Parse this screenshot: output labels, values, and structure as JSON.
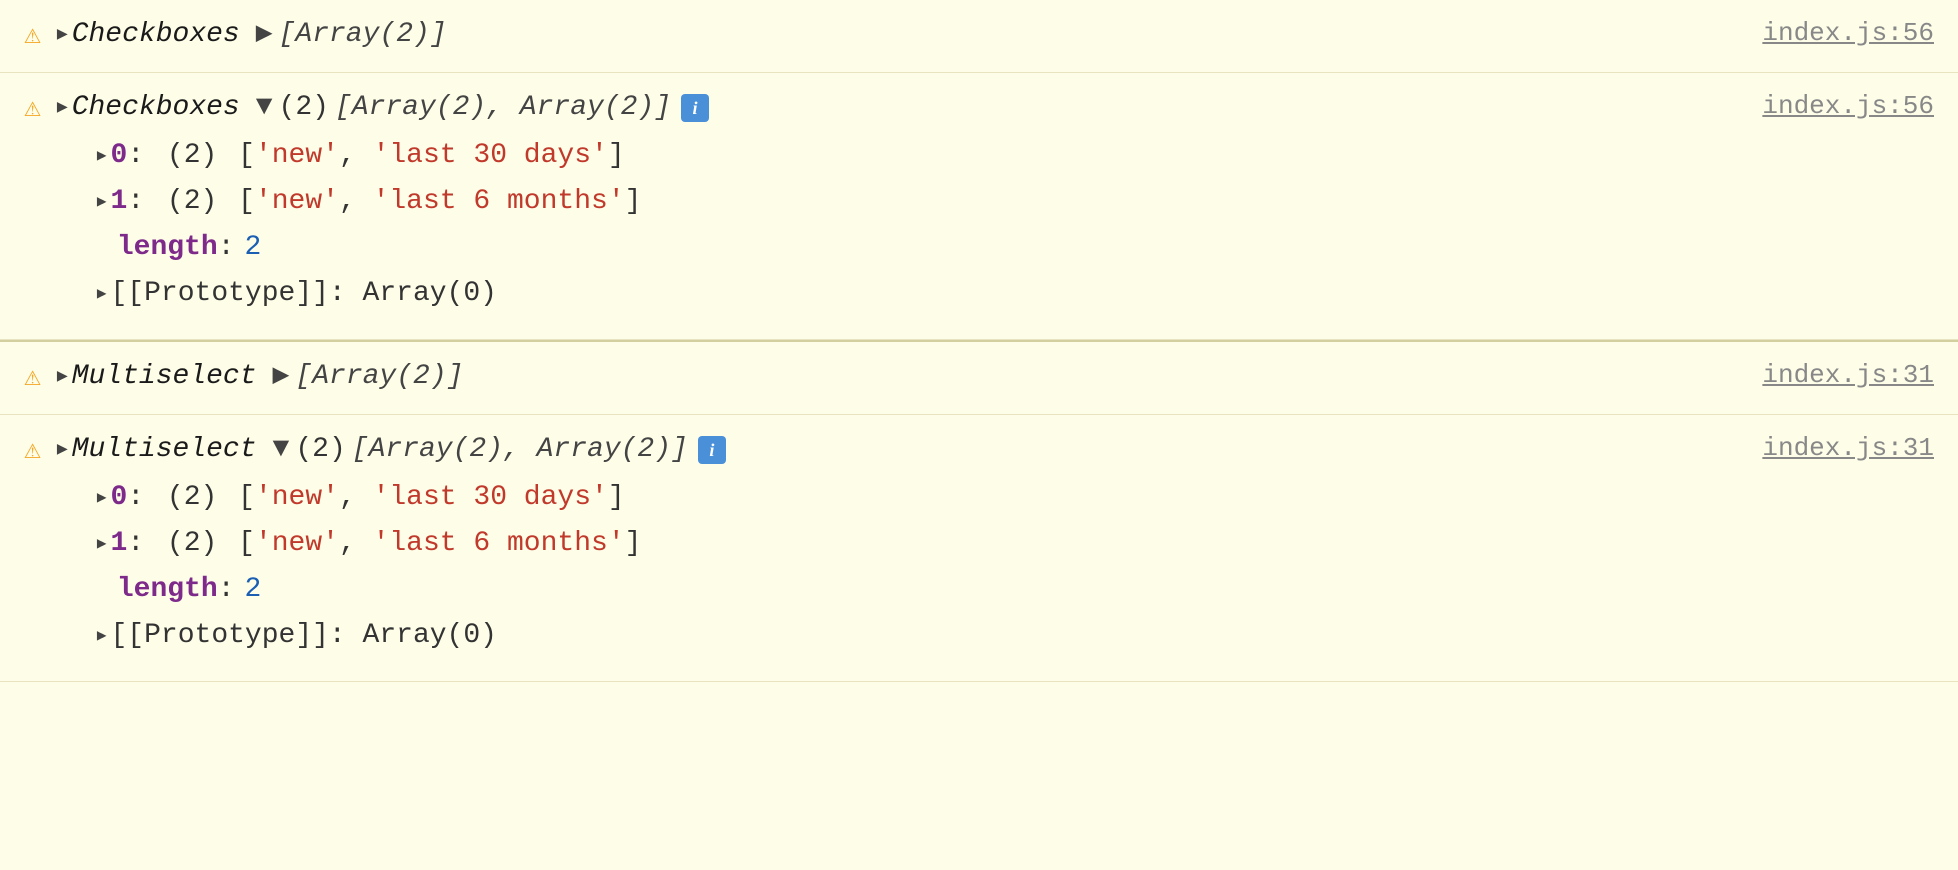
{
  "console": {
    "bg_color": "#fefde8",
    "rows": [
      {
        "id": "row1",
        "type": "collapsed",
        "warning_icon": "⚠",
        "source_name": "Checkboxes",
        "array_preview": "[Array(2)]",
        "file_link": "index.js:56"
      },
      {
        "id": "row2",
        "type": "expanded",
        "warning_icon": "⚠",
        "source_name": "Checkboxes",
        "array_count": "(2)",
        "array_preview": "[Array(2), Array(2)]",
        "has_info": true,
        "file_link": "index.js:56",
        "items": [
          {
            "index": "0",
            "count": "(2)",
            "values": [
              "'new'",
              "'last 30 days'"
            ]
          },
          {
            "index": "1",
            "count": "(2)",
            "values": [
              "'new'",
              "'last 6 months'"
            ]
          }
        ],
        "length_value": "2",
        "prototype_text": "[[Prototype]]: Array(0)"
      },
      {
        "id": "row3",
        "type": "collapsed",
        "warning_icon": "⚠",
        "source_name": "Multiselect",
        "array_preview": "[Array(2)]",
        "file_link": "index.js:31"
      },
      {
        "id": "row4",
        "type": "expanded",
        "warning_icon": "⚠",
        "source_name": "Multiselect",
        "array_count": "(2)",
        "array_preview": "[Array(2), Array(2)]",
        "has_info": true,
        "file_link": "index.js:31",
        "items": [
          {
            "index": "0",
            "count": "(2)",
            "values": [
              "'new'",
              "'last 30 days'"
            ]
          },
          {
            "index": "1",
            "count": "(2)",
            "values": [
              "'new'",
              "'last 6 months'"
            ]
          }
        ],
        "length_value": "2",
        "prototype_text": "[[Prototype]]: Array(0)"
      }
    ]
  }
}
